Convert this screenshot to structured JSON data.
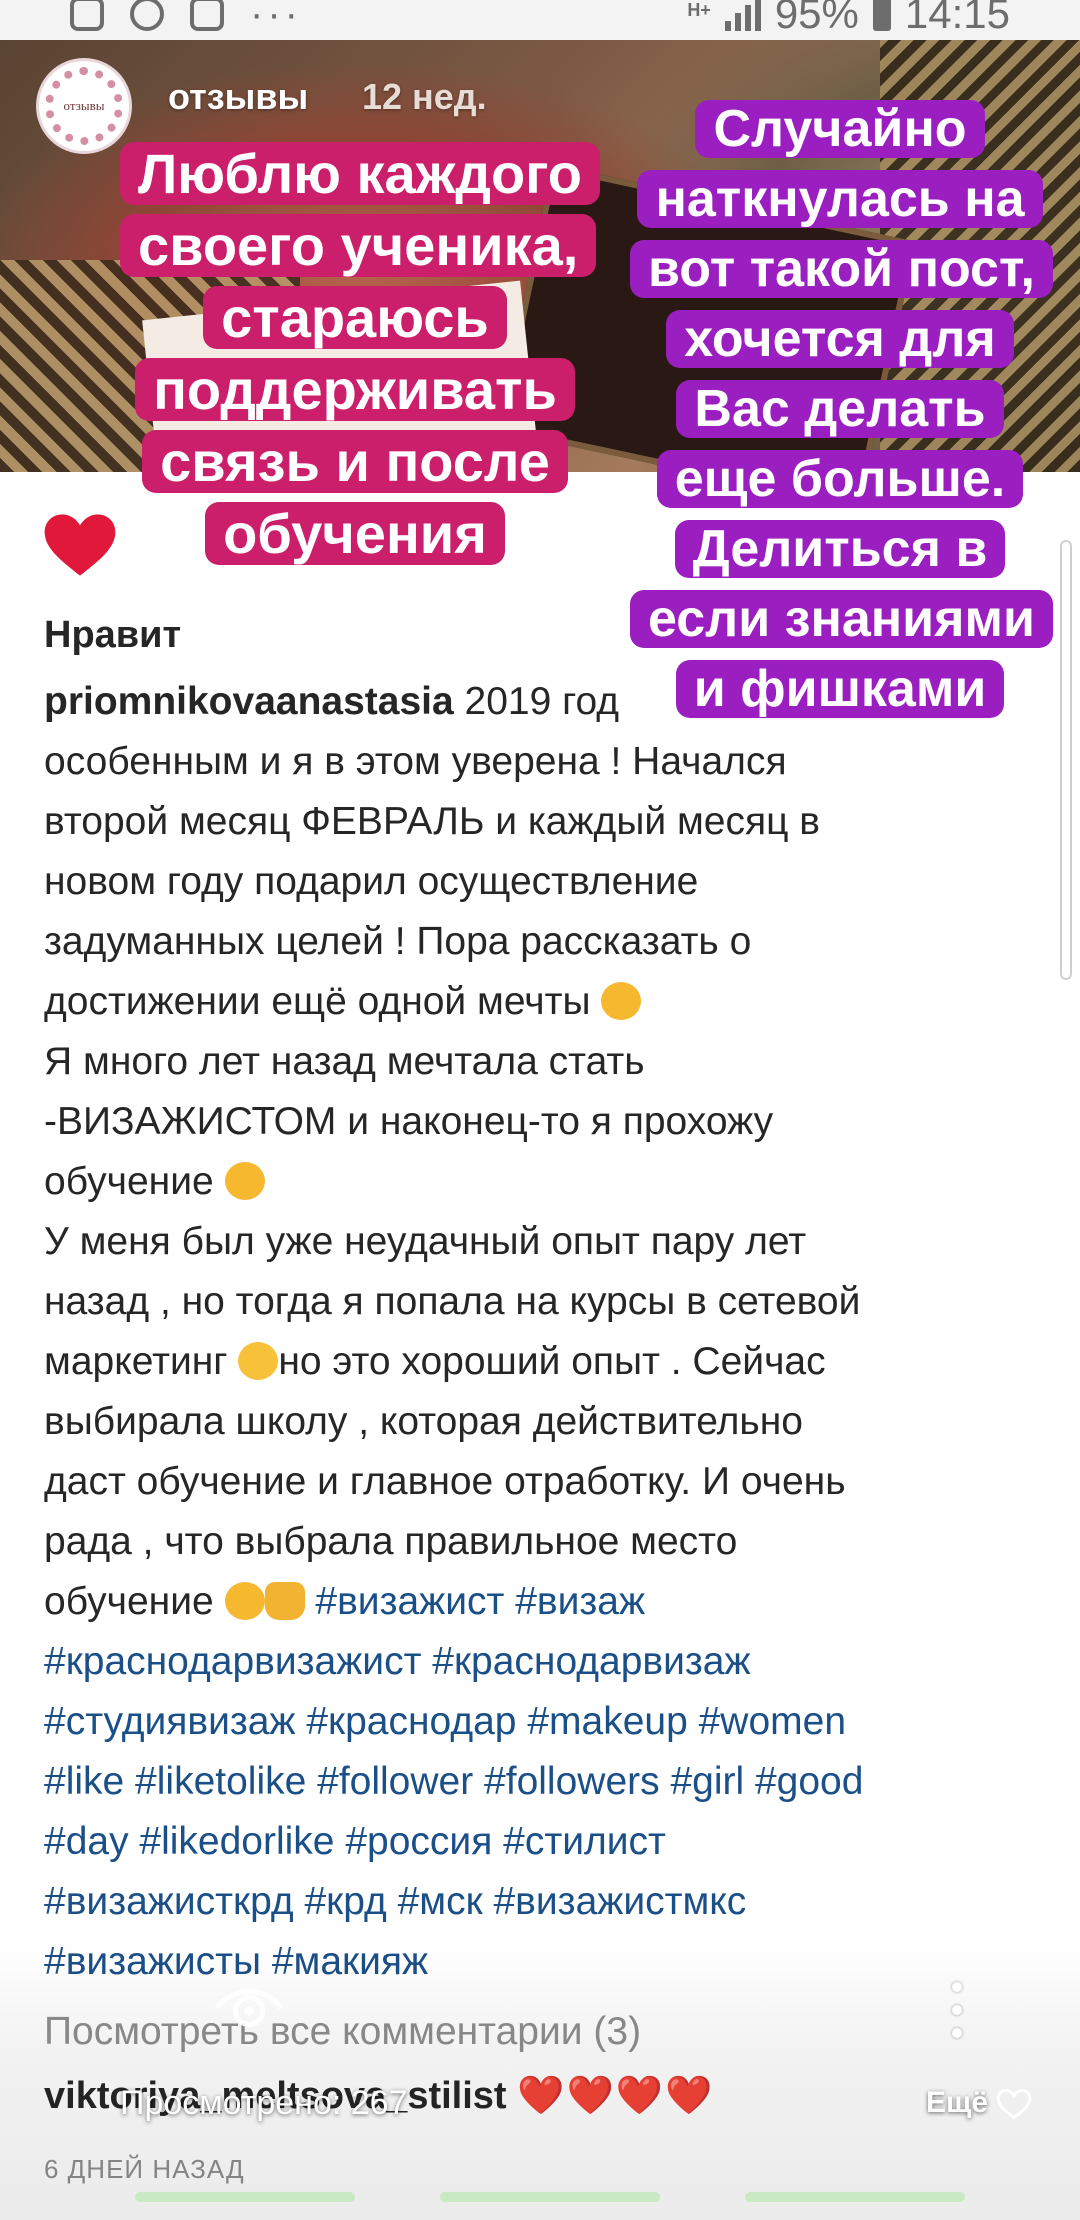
{
  "status_bar": {
    "network_label": "H+",
    "battery": "95%",
    "time": "14:15",
    "left_icons": [
      "gallery-icon",
      "pinterest-icon",
      "instagram-icon",
      "more-dots-icon"
    ]
  },
  "post": {
    "account_name": "отзывы",
    "avatar_label": "отзывы",
    "time_ago": "12 нед.",
    "likes_partial": "Нравит",
    "caption": {
      "username": "priomnikovaanastasia",
      "lines_1": "2019 год",
      "line_2": "особенным и я в этом уверена ! Начался",
      "line_3": "второй месяц ФЕВРАЛЬ  и каждый месяц в",
      "line_4": "новом году подарил осуществление",
      "line_5": "задуманных целей ! Пора рассказать о",
      "line_6": "достижении ещё одной мечты",
      "line_7": "Я много лет назад мечтала стать",
      "line_8": "-ВИЗАЖИСТОМ и наконец-то я прохожу",
      "line_9": "обучение",
      "line_10": "У меня был уже неудачный опыт пару лет",
      "line_11": "назад , но тогда я попала на курсы в сетевой",
      "line_12a": "маркетинг",
      "line_12b": "но это хороший опыт . Сейчас",
      "line_13": "выбирала школу , которая действительно",
      "line_14": "даст обучение и главное отработку. И очень",
      "line_15": "рада , что выбрала правильное место",
      "line_16": "обучение",
      "tags_1": "#визажист #визаж",
      "tags_2": "#краснодарвизажист #краснодарвизаж",
      "tags_3": "#студиявизаж #краснодар #makeup #women",
      "tags_4": "#like #liketolike #follower #followers #girl #good",
      "tags_5": "#day #likedorlike #россия #стилист",
      "tags_6": "#визажисткрд #крд #мск #визажистмкс",
      "tags_7": "#визажисты #макияж"
    },
    "view_all_comments": "Посмотреть все комментарии (3)",
    "comment_user": "viktoriya_meltsova_stilist",
    "comment_hearts": "❤️❤️❤️❤️",
    "date": "6 ДНЕЙ НАЗАД"
  },
  "story": {
    "views": "Просмотрено: 267",
    "more_label": "Ещё",
    "sticker_left": "Люблю каждого своего ученика, стараюсь поддерживать связь и после обучения",
    "sticker_right": "Случайно наткнулась на вот такой пост, хочется для Вас делать еще больше. Делиться в если знаниями и фишками"
  },
  "colors": {
    "sticker_pink": "#cc1f6b",
    "sticker_purple": "#9b1fc0",
    "hashtag": "#1b4f87",
    "heart": "#e0193a"
  }
}
